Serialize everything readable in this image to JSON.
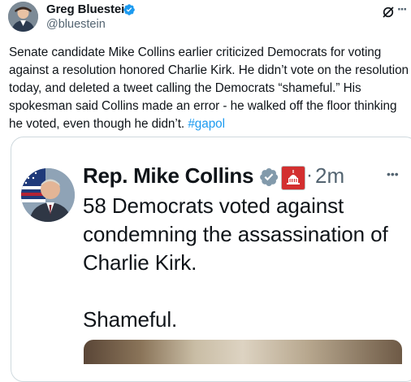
{
  "tweet": {
    "author": {
      "name": "Greg Bluestein",
      "handle": "@bluestein",
      "verified": true,
      "avatar_icon": "profile-photo-icon"
    },
    "text": "Senate candidate Mike Collins earlier criticized Democrats for voting against a resolution honored Charlie Kirk. He didn’t vote on the resolution today, and deleted a tweet calling the Democrats “shameful.” His spokesman said Collins made an error - he walked off the floor thinking he voted, even though he didn’t.",
    "hashtag": "#gapol",
    "colors": {
      "link": "#1d9bf0",
      "verified": "#1d9bf0",
      "secondary_text": "#536471",
      "gray_verified": "#829aab",
      "badge_red": "#d32f2f"
    }
  },
  "quoted": {
    "author": {
      "name": "Rep. Mike Collins",
      "verified_gray": true,
      "affiliate_badge": "capitol-icon",
      "time": "2m"
    },
    "text_line1": "58 Democrats voted against condemning the assassination of Charlie Kirk.",
    "text_line2": "Shameful."
  },
  "icons": {
    "grok": "grok-icon",
    "more": "more-options-icon"
  }
}
